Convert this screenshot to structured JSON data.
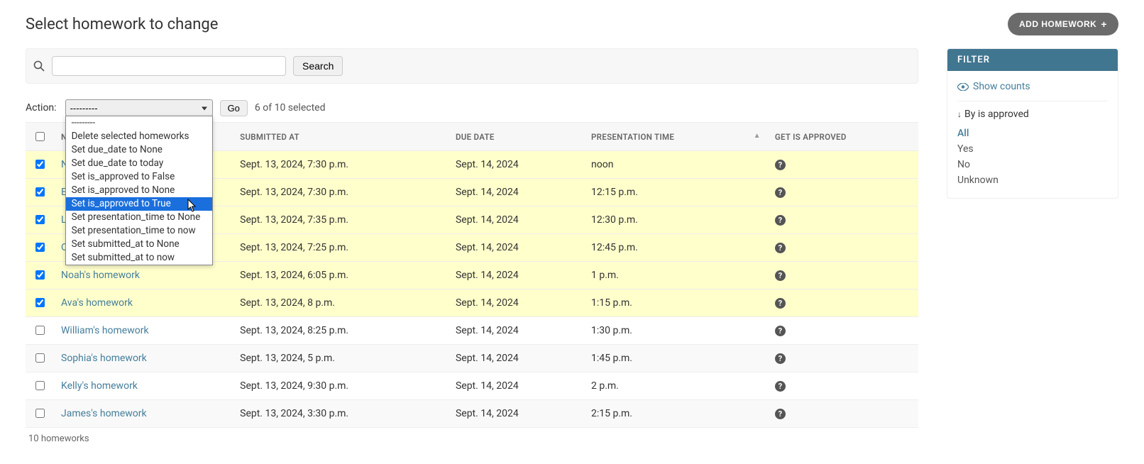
{
  "page_title": "Select homework to change",
  "add_button_label": "ADD HOMEWORK",
  "search": {
    "button": "Search",
    "value": ""
  },
  "actions": {
    "label": "Action:",
    "selected": "---------",
    "go": "Go",
    "selection_text": "6 of 10 selected",
    "options": [
      "---------",
      "Delete selected homeworks",
      "Set due_date to None",
      "Set due_date to today",
      "Set is_approved to False",
      "Set is_approved to None",
      "Set is_approved to True",
      "Set presentation_time to None",
      "Set presentation_time to now",
      "Set submitted_at to None",
      "Set submitted_at to now"
    ],
    "highlighted_index": 6
  },
  "columns": {
    "name": "NAME",
    "submitted_at": "SUBMITTED AT",
    "due_date": "DUE DATE",
    "presentation_time": "PRESENTATION TIME",
    "get_is_approved": "GET IS APPROVED"
  },
  "rows": [
    {
      "selected": true,
      "name": "Nathan's homework",
      "submitted_at": "Sept. 13, 2024, 7:30 p.m.",
      "due_date": "Sept. 14, 2024",
      "presentation_time": "noon"
    },
    {
      "selected": true,
      "name": "Emma's homework",
      "submitted_at": "Sept. 13, 2024, 7:30 p.m.",
      "due_date": "Sept. 14, 2024",
      "presentation_time": "12:15 p.m."
    },
    {
      "selected": true,
      "name": "Liam's homework",
      "submitted_at": "Sept. 13, 2024, 7:35 p.m.",
      "due_date": "Sept. 14, 2024",
      "presentation_time": "12:30 p.m."
    },
    {
      "selected": true,
      "name": "Olivia's homework",
      "submitted_at": "Sept. 13, 2024, 7:25 p.m.",
      "due_date": "Sept. 14, 2024",
      "presentation_time": "12:45 p.m."
    },
    {
      "selected": true,
      "name": "Noah's homework",
      "submitted_at": "Sept. 13, 2024, 6:05 p.m.",
      "due_date": "Sept. 14, 2024",
      "presentation_time": "1 p.m."
    },
    {
      "selected": true,
      "name": "Ava's homework",
      "submitted_at": "Sept. 13, 2024, 8 p.m.",
      "due_date": "Sept. 14, 2024",
      "presentation_time": "1:15 p.m."
    },
    {
      "selected": false,
      "name": "William's homework",
      "submitted_at": "Sept. 13, 2024, 8:25 p.m.",
      "due_date": "Sept. 14, 2024",
      "presentation_time": "1:30 p.m."
    },
    {
      "selected": false,
      "name": "Sophia's homework",
      "submitted_at": "Sept. 13, 2024, 5 p.m.",
      "due_date": "Sept. 14, 2024",
      "presentation_time": "1:45 p.m."
    },
    {
      "selected": false,
      "name": "Kelly's homework",
      "submitted_at": "Sept. 13, 2024, 9:30 p.m.",
      "due_date": "Sept. 14, 2024",
      "presentation_time": "2 p.m."
    },
    {
      "selected": false,
      "name": "James's homework",
      "submitted_at": "Sept. 13, 2024, 3:30 p.m.",
      "due_date": "Sept. 14, 2024",
      "presentation_time": "2:15 p.m."
    }
  ],
  "paginator": "10 homeworks",
  "filter": {
    "header": "FILTER",
    "show_counts": "Show counts",
    "group_label": "By is approved",
    "options": [
      "All",
      "Yes",
      "No",
      "Unknown"
    ],
    "active_index": 0
  }
}
